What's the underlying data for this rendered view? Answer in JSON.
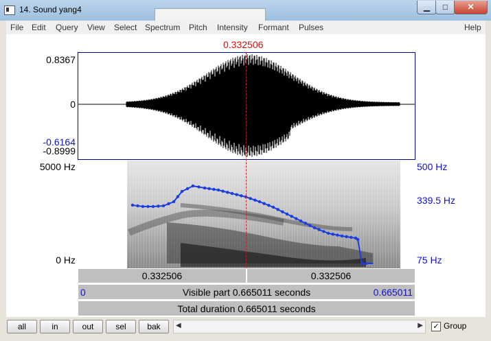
{
  "window": {
    "title": "14. Sound yang4"
  },
  "menu": [
    "File",
    "Edit",
    "Query",
    "View",
    "Select",
    "Spectrum",
    "Pitch",
    "Intensity",
    "Formant",
    "Pulses",
    "Help"
  ],
  "cursor": {
    "time": "0.332506"
  },
  "waveform": {
    "max": "0.8367",
    "zero": "0",
    "sel_min": "-0.6164",
    "min": "-0.8999"
  },
  "spectrogram": {
    "freq_top": "5000 Hz",
    "freq_bottom": "0 Hz",
    "pitch_top": "500 Hz",
    "pitch_mid": "339.5 Hz",
    "pitch_bottom": "75 Hz"
  },
  "time_bars": {
    "left": "0.332506",
    "right": "0.332506",
    "start": "0",
    "visible": "Visible part 0.665011 seconds",
    "end": "0.665011",
    "total": "Total duration 0.665011 seconds"
  },
  "buttons": {
    "all": "all",
    "in": "in",
    "out": "out",
    "sel": "sel",
    "bak": "bak"
  },
  "group": {
    "label": "Group",
    "checked": "✓"
  }
}
